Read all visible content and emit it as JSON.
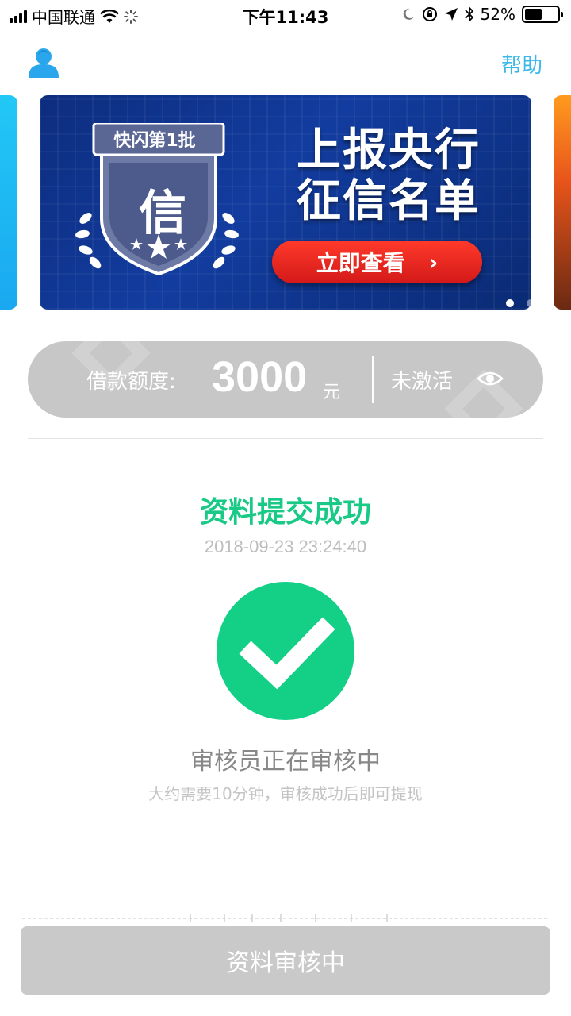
{
  "status_bar": {
    "carrier": "中国联通",
    "time": "下午11:43",
    "battery": "52%",
    "battery_level": 0.52
  },
  "header": {
    "avatar_icon": "user-icon",
    "help_label": "帮助",
    "accent_color": "#3cb8e8"
  },
  "banner": {
    "shield_tag": "快闪第1批",
    "shield_char": "信",
    "title_line1": "上报央行",
    "title_line2": "征信名单",
    "cta_label": "立即查看",
    "cta_arrow": "›",
    "pages": 3,
    "active_page": 0
  },
  "credit": {
    "label": "借款额度:",
    "amount": "3000",
    "unit": "元",
    "status": "未激活",
    "icon": "eye-icon"
  },
  "result": {
    "title": "资料提交成功",
    "timestamp": "2018-09-23 23:24:40",
    "icon": "check-icon",
    "success_color": "#14cf86",
    "review_title": "审核员正在审核中",
    "review_subtitle": "大约需要10分钟，审核成功后即可提现"
  },
  "footer": {
    "button_label": "资料审核中"
  }
}
